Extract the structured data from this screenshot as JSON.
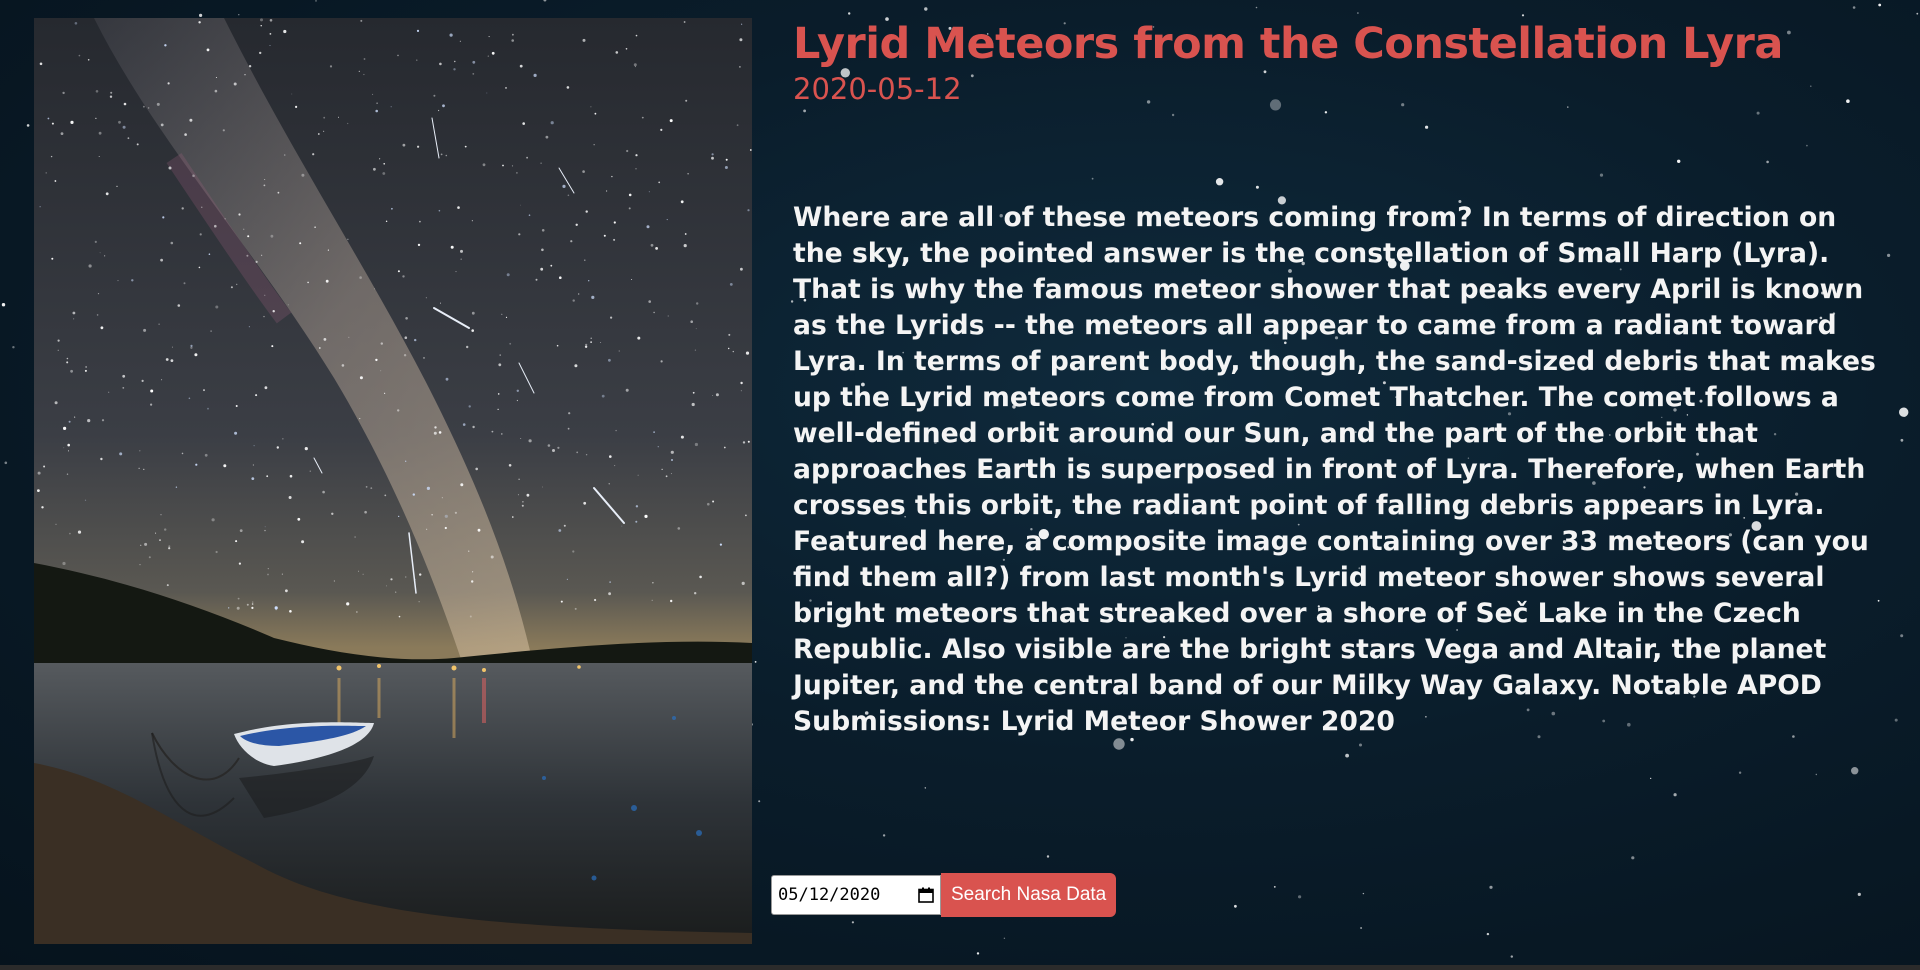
{
  "apod": {
    "title": "Lyrid Meteors from the Constellation Lyra",
    "date": "2020-05-12",
    "explanation": "Where are all of these meteors coming from? In terms of direction on the sky, the pointed answer is the constellation of Small Harp (Lyra). That is why the famous meteor shower that peaks every April is known as the Lyrids -- the meteors all appear to came from a radiant toward Lyra. In terms of parent body, though, the sand-sized debris that makes up the Lyrid meteors come from Comet Thatcher. The comet follows a well-defined orbit around our Sun, and the part of the orbit that approaches Earth is superposed in front of Lyra. Therefore, when Earth crosses this orbit, the radiant point of falling debris appears in Lyra. Featured here, a composite image containing over 33 meteors (can you find them all?) from last month's Lyrid meteor shower shows several bright meteors that streaked over a shore of Seč Lake in the Czech Republic. Also visible are the bright stars Vega and Altair, the planet Jupiter, and the central band of our Milky Way Galaxy. Notable APOD Submissions: Lyrid Meteor Shower 2020"
  },
  "search": {
    "date_value": "05/12/2020",
    "button_label": "Search Nasa Data"
  },
  "colors": {
    "accent": "#d9534f",
    "background": "#0a1d2b",
    "text": "#f4f4f4"
  }
}
